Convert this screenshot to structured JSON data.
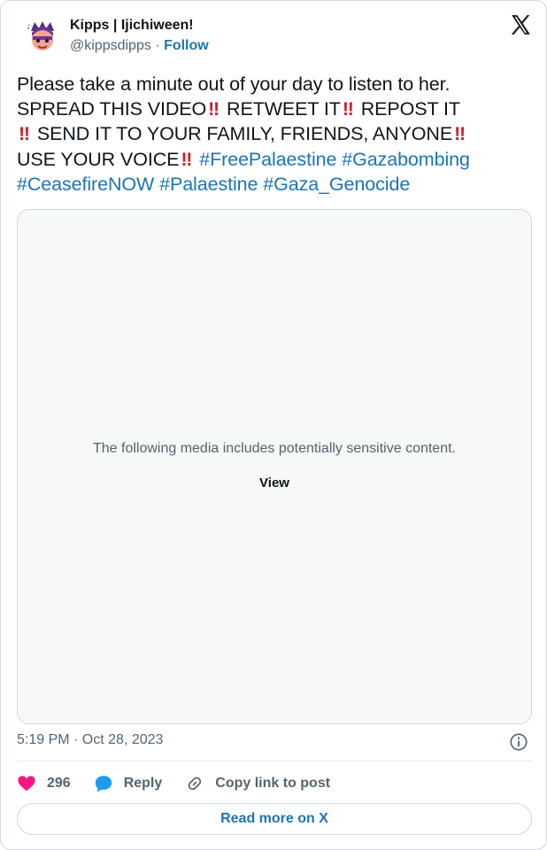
{
  "user": {
    "display_name": "Kipps | Ijichiween!",
    "handle": "@kippsdipps",
    "separator": " · ",
    "follow_label": "Follow"
  },
  "tweet": {
    "line1": "Please take a minute out of your day to listen to her.",
    "seg1": "SPREAD THIS VIDEO",
    "seg2": " RETWEET IT",
    "seg3": " REPOST IT",
    "seg4": " SEND IT TO YOUR FAMILY, FRIENDS, ANYONE",
    "seg5": "USE YOUR VOICE",
    "bang": "‼",
    "hashtags": [
      "#FreePalaestine",
      "#Gazabombing",
      "#CeasefireNOW",
      "#Palaestine",
      "#Gaza_Genocide"
    ]
  },
  "media": {
    "message": "The following media includes potentially sensitive content.",
    "view_label": "View"
  },
  "timestamp": "5:19 PM · Oct 28, 2023",
  "actions": {
    "like_count": "296",
    "reply_label": "Reply",
    "copy_label": "Copy link to post"
  },
  "read_more_label": "Read more on X",
  "colors": {
    "link": "#1d74b3",
    "like": "#f91880",
    "reply": "#1d9bf0",
    "text": "#0f1419",
    "muted": "#536471"
  }
}
